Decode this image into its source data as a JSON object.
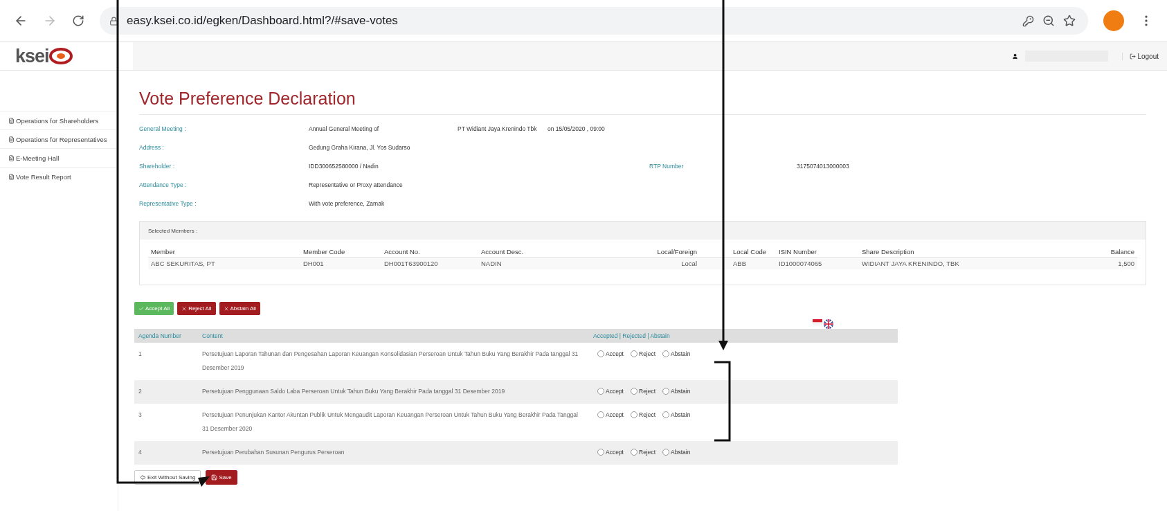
{
  "browser": {
    "url": "easy.ksei.co.id/egken/Dashboard.html?/#save-votes"
  },
  "header": {
    "logo": "ksei",
    "logout": "Logout"
  },
  "sidebar": {
    "items": [
      {
        "label": "Operations for Shareholders"
      },
      {
        "label": "Operations for Representatives"
      },
      {
        "label": "E-Meeting Hall"
      },
      {
        "label": "Vote Result Report"
      }
    ]
  },
  "title": "Vote Preference Declaration",
  "info": [
    {
      "label": "General Meeting :",
      "values": [
        "Annual General Meeting of",
        "PT Widiant Jaya Krenindo Tbk",
        "on 15/05/2020 , 09:00"
      ]
    },
    {
      "label": "Address :",
      "values": [
        "Gedung Graha Kirana, Jl. Yos Sudarso"
      ]
    },
    {
      "label": "Shareholder :",
      "values": [
        "IDD300652580000 / Nadin"
      ],
      "extra_label": "RTP Number",
      "extra_value": "3175074013000003"
    },
    {
      "label": "Attendance Type :",
      "values": [
        "Representative or Proxy attendance"
      ]
    },
    {
      "label": "Representative Type :",
      "values": [
        "With vote preference,  Zamak"
      ]
    }
  ],
  "selected_members": {
    "title": "Selected Members :",
    "columns": [
      "Member",
      "Member Code",
      "Account No.",
      "Account Desc.",
      "Local/Foreign",
      "Local Code",
      "ISIN Number",
      "Share Description",
      "Balance"
    ],
    "rows": [
      [
        "ABC SEKURITAS, PT",
        "DH001",
        "DH001T63900120",
        "NADIN",
        "Local",
        "ABB",
        "ID1000074065",
        "WIDIANT JAYA KRENINDO, TBK",
        "1,500"
      ]
    ]
  },
  "bulk_buttons": [
    {
      "label": "Accept All",
      "kind": "accept"
    },
    {
      "label": "Reject All",
      "kind": "reject"
    },
    {
      "label": "Abstain All",
      "kind": "abstain"
    }
  ],
  "agenda": {
    "columns": [
      "Agenda Number",
      "Content",
      "Accepted | Rejected | Abstain"
    ],
    "rows": [
      {
        "number": "1",
        "content": "Persetujuan Laporan Tahunan dan Pengesahan Laporan Keuangan Konsolidasian Perseroan Untuk Tahun Buku Yang Berakhir Pada tanggal 31 Desember 2019",
        "options": [
          {
            "label": "Accept",
            "selected": false
          },
          {
            "label": "Reject",
            "selected": false
          },
          {
            "label": "Abstain",
            "selected": false
          }
        ]
      },
      {
        "number": "2",
        "content": "Persetujuan Penggunaan Saldo Laba Perseroan Untuk Tahun Buku Yang Berakhir Pada tanggal 31 Desember 2019",
        "options": [
          {
            "label": "Accept",
            "selected": false
          },
          {
            "label": "Reject",
            "selected": false
          },
          {
            "label": "Abstain",
            "selected": false
          }
        ]
      },
      {
        "number": "3",
        "content": "Persetujuan Penunjukan Kantor Akuntan Publik Untuk Mengaudit Laporan Keuangan Perseroan Untuk Tahun Buku Yang Berakhir Pada Tanggal 31 Desember 2020",
        "options": [
          {
            "label": "Accept",
            "selected": false
          },
          {
            "label": "Reject",
            "selected": false
          },
          {
            "label": "Abstain",
            "selected": false
          }
        ]
      },
      {
        "number": "4",
        "content": "Persetujuan Perubahan Susunan Pengurus Perseroan",
        "options": [
          {
            "label": "Accept",
            "selected": false
          },
          {
            "label": "Reject",
            "selected": false
          },
          {
            "label": "Abstain",
            "selected": false
          }
        ]
      }
    ]
  },
  "footer_buttons": [
    {
      "label": "Exit Without Saving",
      "kind": "exit"
    },
    {
      "label": "Save",
      "kind": "save"
    }
  ]
}
